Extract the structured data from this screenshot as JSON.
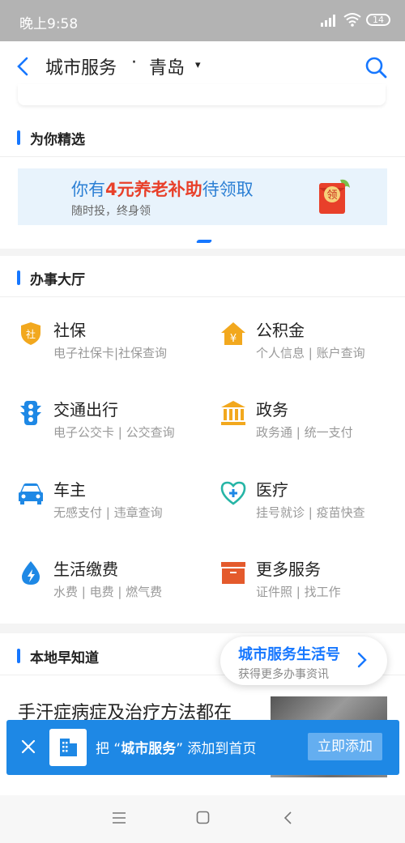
{
  "status_bar": {
    "time": "晚上9:58",
    "battery": "14"
  },
  "header": {
    "title": "城市服务",
    "separator": "·",
    "city": "青岛",
    "caret": "▾"
  },
  "featured": {
    "section_title": "为你精选",
    "banner": {
      "prefix": "你有",
      "highlight": "4元养老补助",
      "suffix": "待领取",
      "subtitle": "随时投，终身领",
      "envelope_label": "领"
    }
  },
  "hall": {
    "section_title": "办事大厅",
    "services": [
      {
        "name": "社保",
        "desc": "电子社保卡|社保查询",
        "icon": "shield-icon",
        "icon_glyph": "社"
      },
      {
        "name": "公积金",
        "desc": "个人信息 | 账户查询",
        "icon": "house-yen-icon",
        "icon_glyph": "¥"
      },
      {
        "name": "交通出行",
        "desc": "电子公交卡 | 公交查询",
        "icon": "traffic-light-icon"
      },
      {
        "name": "政务",
        "desc": "政务通 | 统一支付",
        "icon": "government-building-icon"
      },
      {
        "name": "车主",
        "desc": "无感支付 | 违章查询",
        "icon": "car-icon"
      },
      {
        "name": "医疗",
        "desc": "挂号就诊 | 疫苗快查",
        "icon": "medical-heart-icon"
      },
      {
        "name": "生活缴费",
        "desc": "水费 | 电费 | 燃气费",
        "icon": "water-drop-bolt-icon"
      },
      {
        "name": "更多服务",
        "desc": "证件照 | 找工作",
        "icon": "box-icon"
      }
    ]
  },
  "local": {
    "section_title": "本地早知道",
    "news_title": "手汗症病症及治疗方法都在"
  },
  "floating_card": {
    "title": "城市服务生活号",
    "subtitle": "获得更多办事资讯"
  },
  "add_bar": {
    "text_prefix": "把 “",
    "app_name": "城市服务",
    "text_suffix": "” 添加到首页",
    "button": "立即添加"
  },
  "nav_bar": {
    "items": [
      "menu",
      "home",
      "back"
    ]
  },
  "colors": {
    "accent": "#1677ff",
    "icon_orange": "#f2a81e",
    "icon_blue": "#1e88e5",
    "icon_red": "#e45a2c",
    "highlight_red": "#e8402a"
  }
}
